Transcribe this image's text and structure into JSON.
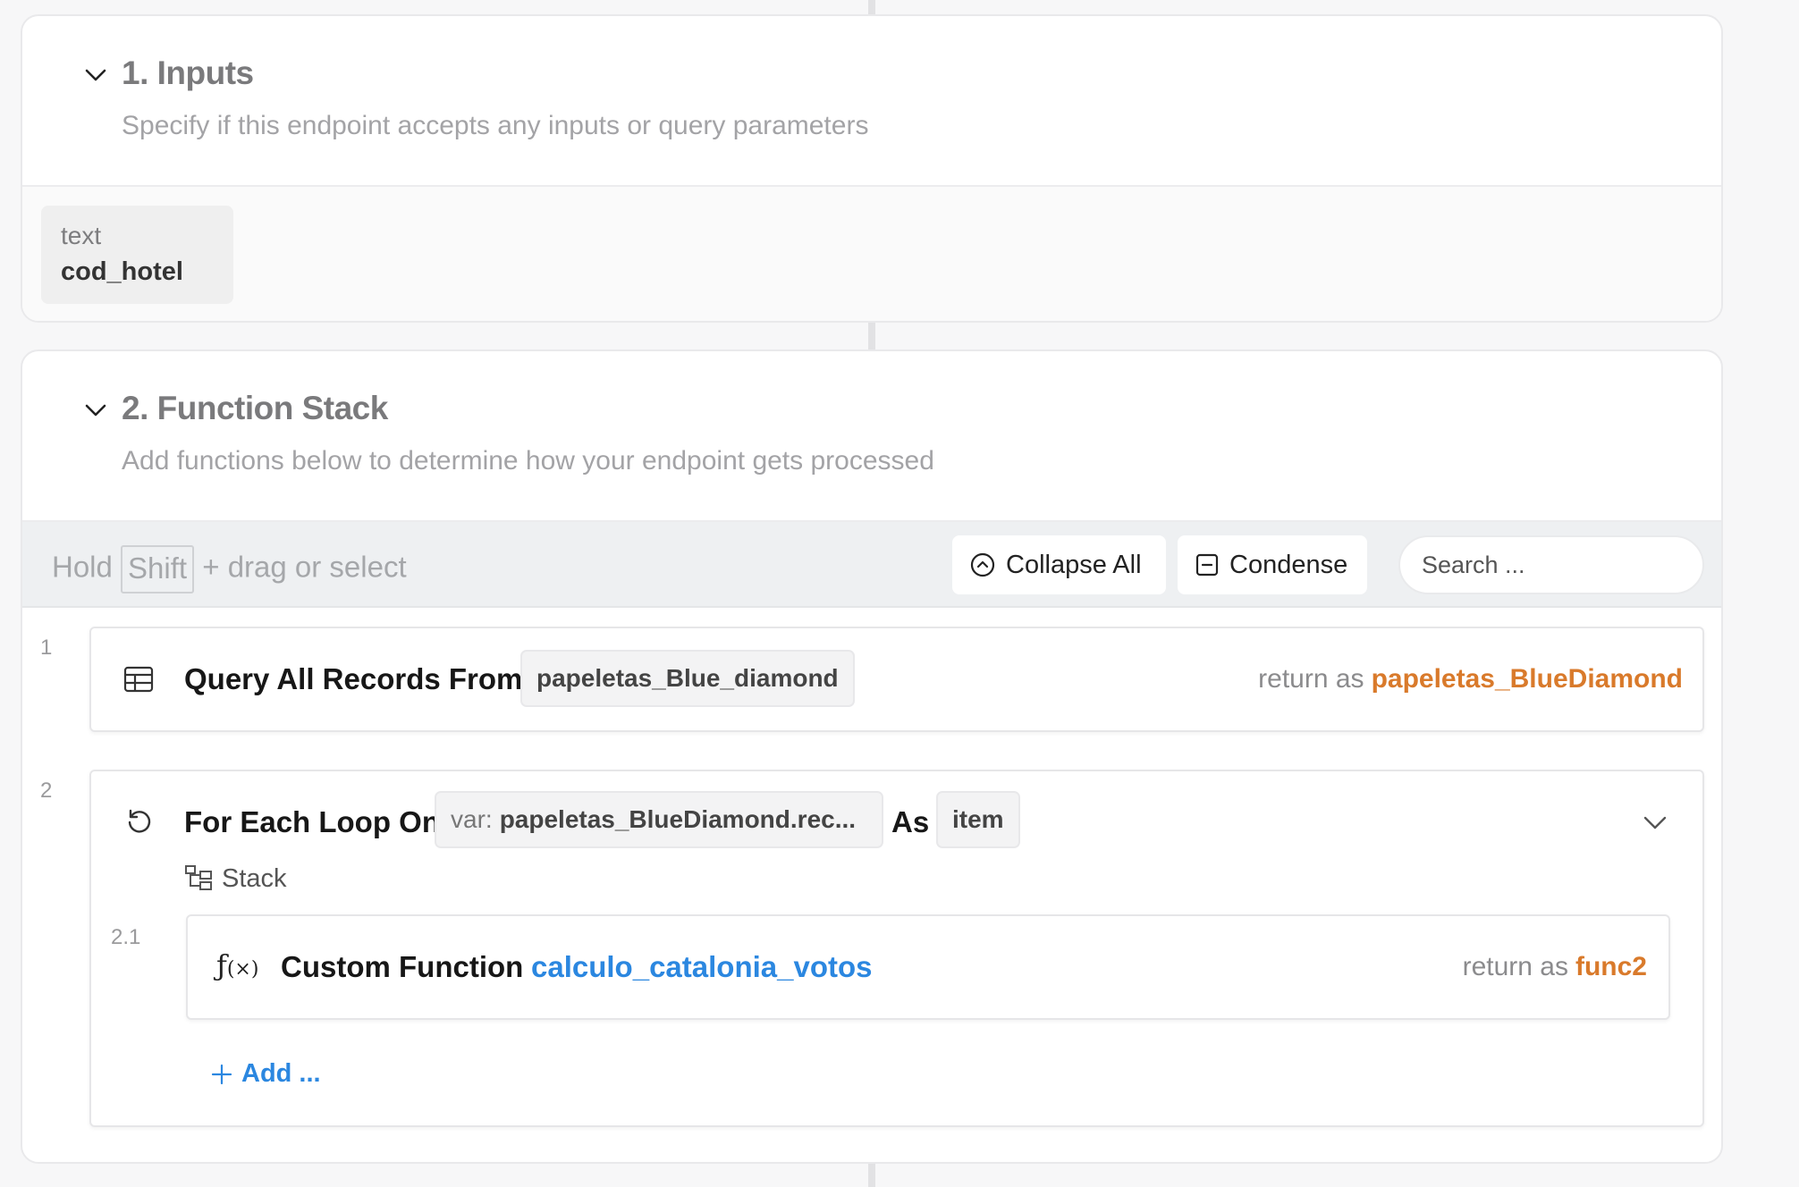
{
  "inputs": {
    "title": "1. Inputs",
    "subtitle": "Specify if this endpoint accepts any inputs or query parameters",
    "items": [
      {
        "type": "text",
        "name": "cod_hotel"
      }
    ]
  },
  "stack": {
    "title": "2. Function Stack",
    "subtitle": "Add functions below to determine how your endpoint gets processed",
    "toolbar": {
      "hint_prefix": "Hold",
      "hint_key": "Shift",
      "hint_suffix": "+ drag or select",
      "collapse_label": "Collapse All",
      "condense_label": "Condense",
      "search_placeholder": "Search ..."
    },
    "steps": [
      {
        "number": "1",
        "label": "Query All Records From",
        "table": "papeletas_Blue_diamond",
        "return_prefix": "return as",
        "return_var": "papeletas_BlueDiamond"
      },
      {
        "number": "2",
        "label": "For Each Loop On",
        "var_prefix": "var:",
        "var_value": "papeletas_BlueDiamond.rec...",
        "as_label": "As",
        "as_value": "item",
        "stack_label": "Stack",
        "children": [
          {
            "number": "2.1",
            "label": "Custom Function",
            "function_name": "calculo_catalonia_votos",
            "return_prefix": "return as",
            "return_var": "func2"
          }
        ],
        "add_label": "Add ..."
      }
    ]
  },
  "colors": {
    "accent_orange": "#d97a2b",
    "accent_blue": "#2b87e0"
  }
}
